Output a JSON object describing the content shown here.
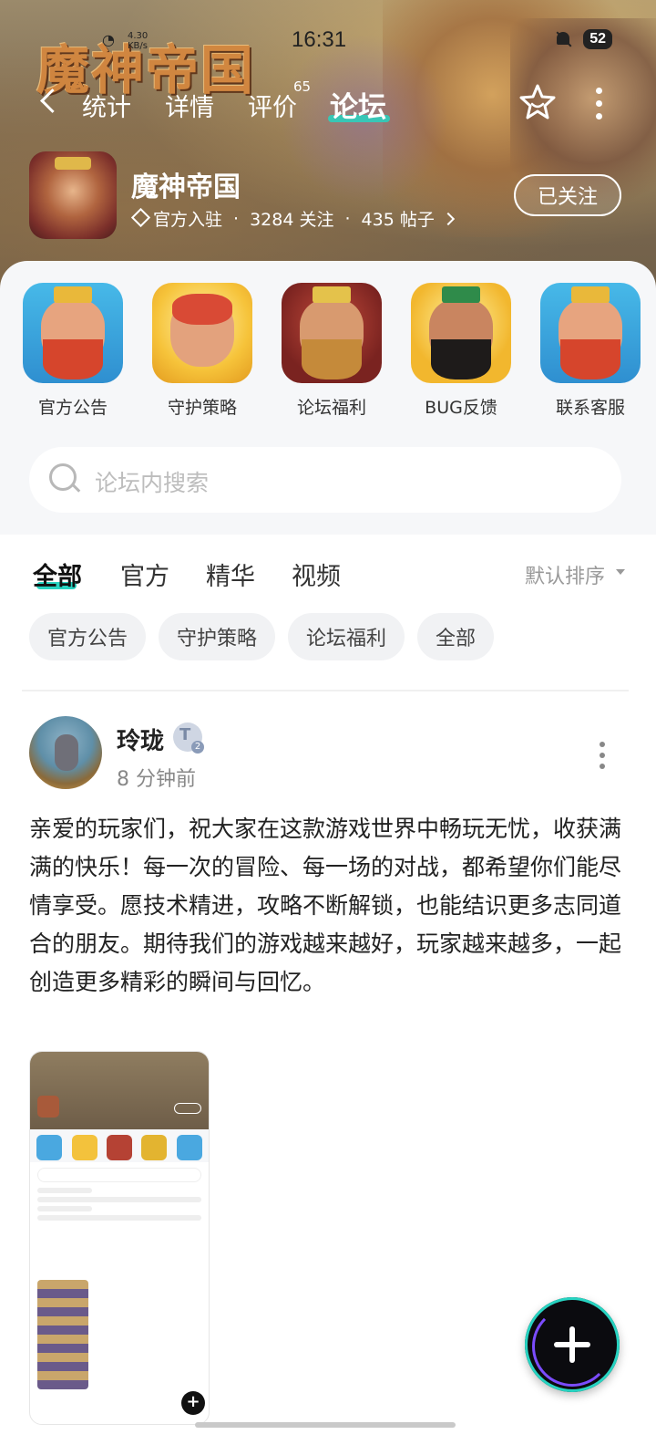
{
  "game_logo": "魔神帝国",
  "status": {
    "time": "16:31",
    "speed": "4.30 KB/s",
    "battery": "52"
  },
  "nav": {
    "tabs": [
      "统计",
      "详情",
      "评价",
      "论坛"
    ],
    "review_count": "65",
    "active": "论坛"
  },
  "forum": {
    "name": "魔神帝国",
    "official": "官方入驻",
    "followers": "3284 关注",
    "posts": "435 帖子",
    "separator": "·",
    "follow_label": "已关注"
  },
  "categories": [
    {
      "label": "官方公告"
    },
    {
      "label": "守护策略"
    },
    {
      "label": "论坛福利"
    },
    {
      "label": "BUG反馈"
    },
    {
      "label": "联系客服"
    }
  ],
  "search": {
    "placeholder": "论坛内搜索"
  },
  "filter_tabs": [
    "全部",
    "官方",
    "精华",
    "视频"
  ],
  "sort_label": "默认排序",
  "chips": [
    "官方公告",
    "守护策略",
    "论坛福利",
    "全部"
  ],
  "post": {
    "author": "玲珑",
    "time": "8 分钟前",
    "body": "亲爱的玩家们，祝大家在这款游戏世界中畅玩无忧，收获满满的快乐！每一次的冒险、每一场的对战，都希望你们能尽情享受。愿技术精进，攻略不断解锁，也能结识更多志同道合的朋友。期待我们的游戏越来越好，玩家越来越多，一起创造更多精彩的瞬间与回忆。"
  },
  "colors": {
    "accent": "#27d3c1",
    "page_bg": "#f6f7f9"
  }
}
